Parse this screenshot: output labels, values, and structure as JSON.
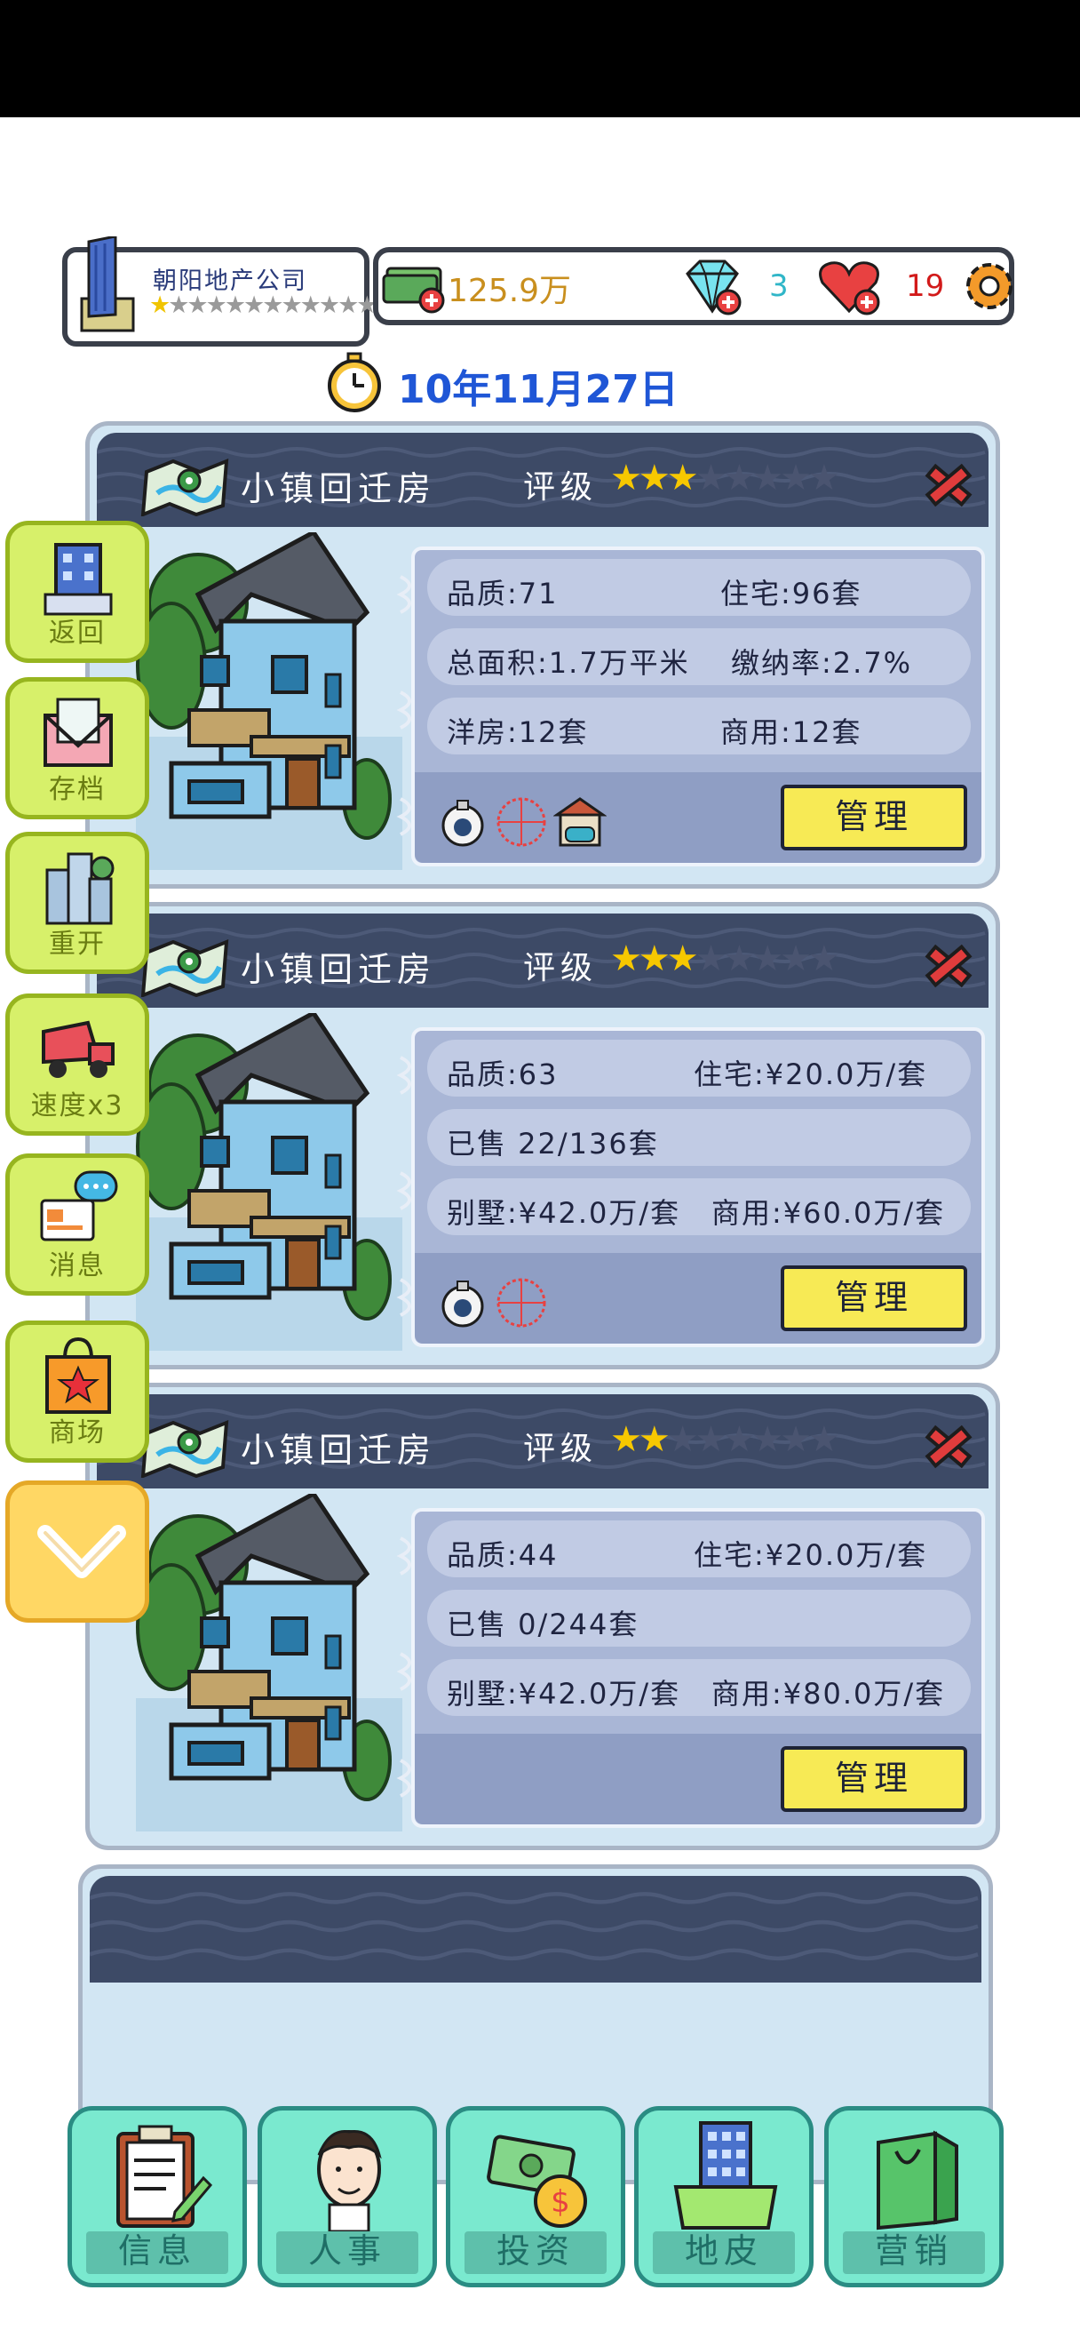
{
  "company": {
    "name": "朝阳地产公司",
    "stars_filled": 1,
    "stars_total": 14,
    "icon": "office-building-icon"
  },
  "resources": {
    "money": "125.9万",
    "diamonds": "3",
    "hearts": "19",
    "money_icon": "cash-stack-icon",
    "diamond_icon": "diamond-icon",
    "heart_icon": "heart-icon",
    "settings_icon": "gear-icon"
  },
  "date": "10年11月27日",
  "cards": [
    {
      "title": "小镇回迁房",
      "rating_label": "评级",
      "stars_filled": 3,
      "stars_total": 8,
      "row1_left": "品质:71",
      "row1_right": "住宅:96套",
      "row2": "总面积:1.7万平米",
      "row2_right": "缴纳率:2.7%",
      "row3_left": "洋房:12套",
      "row3_right": "商用:12套",
      "amenities": [
        "security-camera-icon",
        "ferris-wheel-icon",
        "garage-icon"
      ],
      "manage": "管理"
    },
    {
      "title": "小镇回迁房",
      "rating_label": "评级",
      "stars_filled": 3,
      "stars_total": 8,
      "row1_left": "品质:63",
      "row1_right": "住宅:¥20.0万/套",
      "row2": "已售 22/136套",
      "row3_left": "别墅:¥42.0万/套",
      "row3_right": "商用:¥60.0万/套",
      "amenities": [
        "security-camera-icon",
        "ferris-wheel-icon"
      ],
      "manage": "管理"
    },
    {
      "title": "小镇回迁房",
      "rating_label": "评级",
      "stars_filled": 2,
      "stars_total": 8,
      "row1_left": "品质:44",
      "row1_right": "住宅:¥20.0万/套",
      "row2": "已售 0/244套",
      "row3_left": "别墅:¥42.0万/套",
      "row3_right": "商用:¥80.0万/套",
      "amenities": [],
      "manage": "管理"
    }
  ],
  "side_menu": [
    {
      "label": "返回",
      "icon": "building-icon"
    },
    {
      "label": "存档",
      "icon": "envelope-icon"
    },
    {
      "label": "重开",
      "icon": "city-icon"
    },
    {
      "label": "速度x3",
      "icon": "truck-icon"
    },
    {
      "label": "消息",
      "icon": "message-icon"
    },
    {
      "label": "商场",
      "icon": "shopping-bag-icon"
    }
  ],
  "collapse_icon": "chevron-down-icon",
  "bottom_nav": [
    {
      "label": "信息",
      "icon": "clipboard-icon"
    },
    {
      "label": "人事",
      "icon": "person-icon"
    },
    {
      "label": "投资",
      "icon": "money-icon"
    },
    {
      "label": "地皮",
      "icon": "land-building-icon"
    },
    {
      "label": "营销",
      "icon": "shopping-bag-icon"
    }
  ],
  "colors": {
    "header_navy": "#3d4a66",
    "card_bg": "#d2e6f3",
    "manage_yellow": "#f7ea55",
    "side_green": "#d7f06a",
    "nav_teal": "#7ae9cf",
    "date_blue": "#1f56d6",
    "money_gold": "#c98f1e",
    "diamond_cyan": "#30b6c8",
    "heart_red": "#d21a1a"
  }
}
